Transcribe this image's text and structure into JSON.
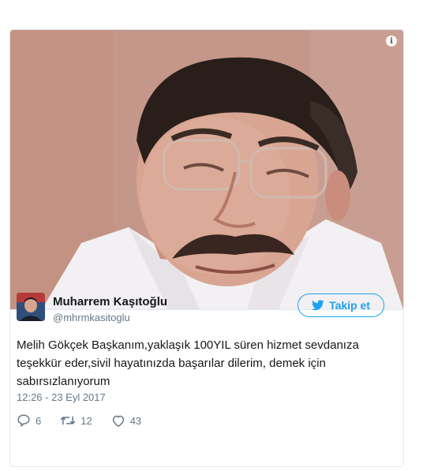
{
  "photo": {
    "alt": "",
    "info_glyph": "i"
  },
  "author": {
    "name": "Muharrem Kaşıtoğlu",
    "handle": "@mhrmkasitoglu"
  },
  "follow": {
    "label": "Takip et",
    "icon": "twitter-bird-icon"
  },
  "tweet": {
    "text": "Melih Gökçek Başkanım,yaklaşık 100YIL süren hizmet sevdanıza teşekkür eder,sivil hayatınızda başarılar dilerim, demek için sabırsızlanıyorum",
    "timestamp": "12:26 - 23 Eyl 2017"
  },
  "stats": {
    "replies": "6",
    "retweets": "12",
    "likes": "43"
  },
  "colors": {
    "accent": "#1da1f2",
    "text": "#14171a",
    "muted": "#657786",
    "border": "#e1e8ed"
  }
}
